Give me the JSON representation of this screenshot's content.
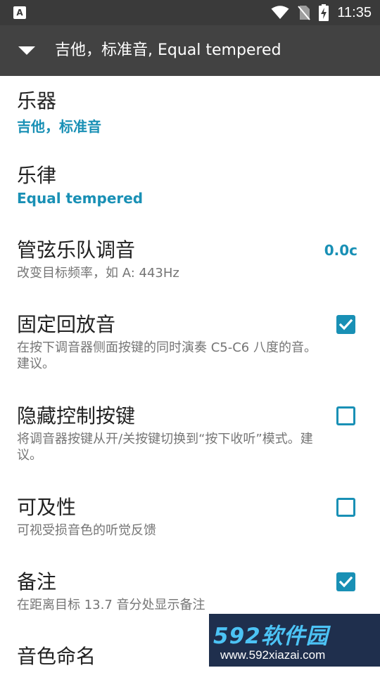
{
  "status_bar": {
    "app_icon_letter": "A",
    "time": "11:35"
  },
  "toolbar": {
    "title": "吉他，标准音, Equal tempered"
  },
  "preferences": {
    "instrument": {
      "title": "乐器",
      "value": "吉他，标准音"
    },
    "temperament": {
      "title": "乐律",
      "value": "Equal tempered"
    },
    "orchestra_tuning": {
      "title": "管弦乐队调音",
      "summary": "改变目标频率，如 A: 443Hz",
      "value": "0.0c"
    },
    "fixed_playback": {
      "title": "固定回放音",
      "summary": "在按下调音器侧面按键的同时演奏 C5-C6 八度的音。建议。",
      "checked": true
    },
    "hide_controls": {
      "title": "隐藏控制按键",
      "summary": "将调音器按键从开/关按键切换到“按下收听”模式。建议。",
      "checked": false
    },
    "accessibility": {
      "title": "可及性",
      "summary": "可视受损音色的听觉反馈",
      "checked": false
    },
    "notes": {
      "title": "备注",
      "summary": "在距离目标 13.7 音分处显示备注",
      "checked": true
    },
    "note_naming": {
      "title": "音色命名"
    }
  },
  "watermark": {
    "brand": "592软件园",
    "url": "www.592xiazai.com"
  },
  "colors": {
    "accent": "#1990b5",
    "toolbar": "#424242",
    "status_bar": "#3a3a3a"
  }
}
